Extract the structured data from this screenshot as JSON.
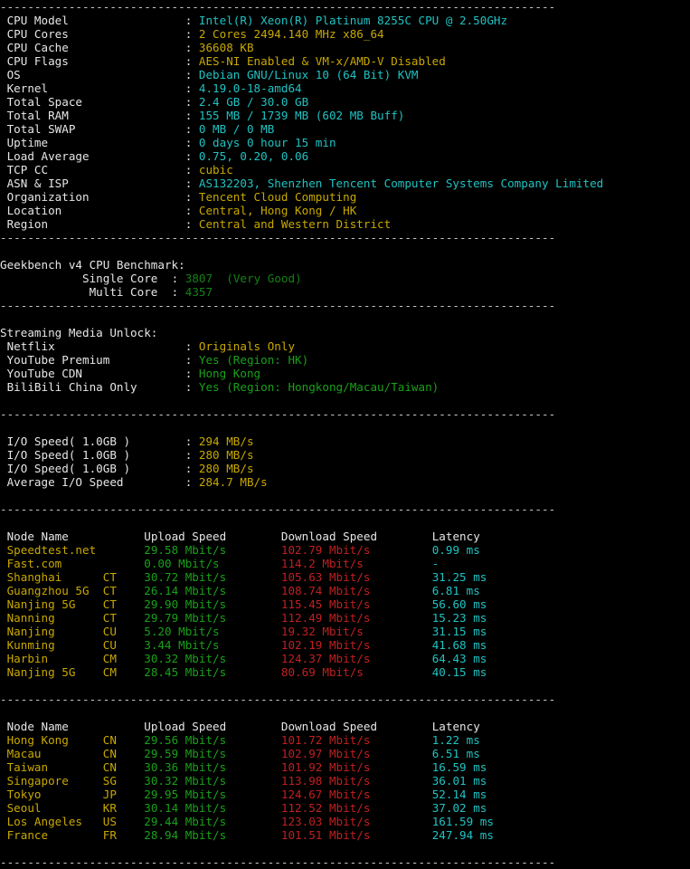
{
  "separator": "---------------------------------------------------------------------------------",
  "system_info": {
    "rows": [
      {
        "label": "CPU Model",
        "value": "Intel(R) Xeon(R) Platinum 8255C CPU @ 2.50GHz",
        "color": "cyan"
      },
      {
        "label": "CPU Cores",
        "value": "2 Cores 2494.140 MHz x86_64",
        "color": "yellow"
      },
      {
        "label": "CPU Cache",
        "value": "36608 KB",
        "color": "yellow"
      },
      {
        "label": "CPU Flags",
        "value": "AES-NI Enabled & VM-x/AMD-V Disabled",
        "color": "yellow"
      },
      {
        "label": "OS",
        "value": "Debian GNU/Linux 10 (64 Bit) KVM",
        "color": "cyan"
      },
      {
        "label": "Kernel",
        "value": "4.19.0-18-amd64",
        "color": "cyan"
      },
      {
        "label": "Total Space",
        "value": "2.4 GB / 30.0 GB",
        "color": "cyan"
      },
      {
        "label": "Total RAM",
        "value": "155 MB / 1739 MB (602 MB Buff)",
        "color": "cyan"
      },
      {
        "label": "Total SWAP",
        "value": "0 MB / 0 MB",
        "color": "cyan"
      },
      {
        "label": "Uptime",
        "value": "0 days 0 hour 15 min",
        "color": "cyan"
      },
      {
        "label": "Load Average",
        "value": "0.75, 0.20, 0.06",
        "color": "cyan"
      },
      {
        "label": "TCP CC",
        "value": "cubic",
        "color": "yellow"
      },
      {
        "label": "ASN & ISP",
        "value": "AS132203, Shenzhen Tencent Computer Systems Company Limited",
        "color": "cyan"
      },
      {
        "label": "Organization",
        "value": "Tencent Cloud Computing",
        "color": "yellow"
      },
      {
        "label": "Location",
        "value": "Central, Hong Kong / HK",
        "color": "yellow"
      },
      {
        "label": "Region",
        "value": "Central and Western District",
        "color": "yellow"
      }
    ]
  },
  "geekbench": {
    "title": "Geekbench v4 CPU Benchmark:",
    "rows": [
      {
        "label": "Single Core",
        "value": "3807",
        "note": "(Very Good)"
      },
      {
        "label": "Multi Core",
        "value": "4357",
        "note": ""
      }
    ]
  },
  "streaming": {
    "title": "Streaming Media Unlock:",
    "rows": [
      {
        "label": "Netflix",
        "value": "Originals Only",
        "color": "yellow"
      },
      {
        "label": "YouTube Premium",
        "value": "Yes (Region: HK)",
        "color": "green"
      },
      {
        "label": "YouTube CDN",
        "value": "Hong Kong",
        "color": "green"
      },
      {
        "label": "BiliBili China Only",
        "value": "Yes (Region: Hongkong/Macau/Taiwan)",
        "color": "green"
      }
    ]
  },
  "io": {
    "rows": [
      {
        "label": "I/O Speed( 1.0GB )",
        "value": "294 MB/s"
      },
      {
        "label": "I/O Speed( 1.0GB )",
        "value": "280 MB/s"
      },
      {
        "label": "I/O Speed( 1.0GB )",
        "value": "280 MB/s"
      },
      {
        "label": "Average I/O Speed",
        "value": "284.7 MB/s"
      }
    ]
  },
  "speedtest_headers": {
    "node": "Node Name",
    "upload": "Upload Speed",
    "download": "Download Speed",
    "latency": "Latency"
  },
  "speedtest_domestic": {
    "rows": [
      {
        "node": "Speedtest.net",
        "carrier": "",
        "upload": "29.58 Mbit/s",
        "download": "102.79 Mbit/s",
        "latency": "0.99 ms"
      },
      {
        "node": "Fast.com",
        "carrier": "",
        "upload": "0.00 Mbit/s",
        "download": "114.2 Mbit/s",
        "latency": "-"
      },
      {
        "node": "Shanghai",
        "carrier": "CT",
        "upload": "30.72 Mbit/s",
        "download": "105.63 Mbit/s",
        "latency": "31.25 ms"
      },
      {
        "node": "Guangzhou 5G",
        "carrier": "CT",
        "upload": "26.14 Mbit/s",
        "download": "108.74 Mbit/s",
        "latency": "6.81 ms"
      },
      {
        "node": "Nanjing 5G",
        "carrier": "CT",
        "upload": "29.90 Mbit/s",
        "download": "115.45 Mbit/s",
        "latency": "56.60 ms"
      },
      {
        "node": "Nanning",
        "carrier": "CT",
        "upload": "29.79 Mbit/s",
        "download": "112.49 Mbit/s",
        "latency": "15.23 ms"
      },
      {
        "node": "Nanjing",
        "carrier": "CU",
        "upload": "5.20 Mbit/s",
        "download": "19.32 Mbit/s",
        "latency": "31.15 ms"
      },
      {
        "node": "Kunming",
        "carrier": "CU",
        "upload": "3.44 Mbit/s",
        "download": "102.19 Mbit/s",
        "latency": "41.68 ms"
      },
      {
        "node": "Harbin",
        "carrier": "CM",
        "upload": "30.32 Mbit/s",
        "download": "124.37 Mbit/s",
        "latency": "64.43 ms"
      },
      {
        "node": "Nanjing 5G",
        "carrier": "CM",
        "upload": "28.45 Mbit/s",
        "download": "80.69 Mbit/s",
        "latency": "40.15 ms"
      }
    ]
  },
  "speedtest_international": {
    "rows": [
      {
        "node": "Hong Kong",
        "carrier": "CN",
        "upload": "29.56 Mbit/s",
        "download": "101.72 Mbit/s",
        "latency": "1.22 ms"
      },
      {
        "node": "Macau",
        "carrier": "CN",
        "upload": "29.59 Mbit/s",
        "download": "102.97 Mbit/s",
        "latency": "6.51 ms"
      },
      {
        "node": "Taiwan",
        "carrier": "CN",
        "upload": "30.36 Mbit/s",
        "download": "101.92 Mbit/s",
        "latency": "16.59 ms"
      },
      {
        "node": "Singapore",
        "carrier": "SG",
        "upload": "30.32 Mbit/s",
        "download": "113.98 Mbit/s",
        "latency": "36.01 ms"
      },
      {
        "node": "Tokyo",
        "carrier": "JP",
        "upload": "29.95 Mbit/s",
        "download": "124.67 Mbit/s",
        "latency": "52.14 ms"
      },
      {
        "node": "Seoul",
        "carrier": "KR",
        "upload": "30.14 Mbit/s",
        "download": "112.52 Mbit/s",
        "latency": "37.02 ms"
      },
      {
        "node": "Los Angeles",
        "carrier": "US",
        "upload": "29.44 Mbit/s",
        "download": "123.03 Mbit/s",
        "latency": "161.59 ms"
      },
      {
        "node": "France",
        "carrier": "FR",
        "upload": "28.94 Mbit/s",
        "download": "101.51 Mbit/s",
        "latency": "247.94 ms"
      }
    ]
  },
  "colors": {
    "background": "#000000",
    "label": "#e6e6e6",
    "cyan": "#20c2c2",
    "yellow": "#c8a800",
    "green": "#19a019",
    "red": "#c02020",
    "separator": "#c8c8c8"
  }
}
